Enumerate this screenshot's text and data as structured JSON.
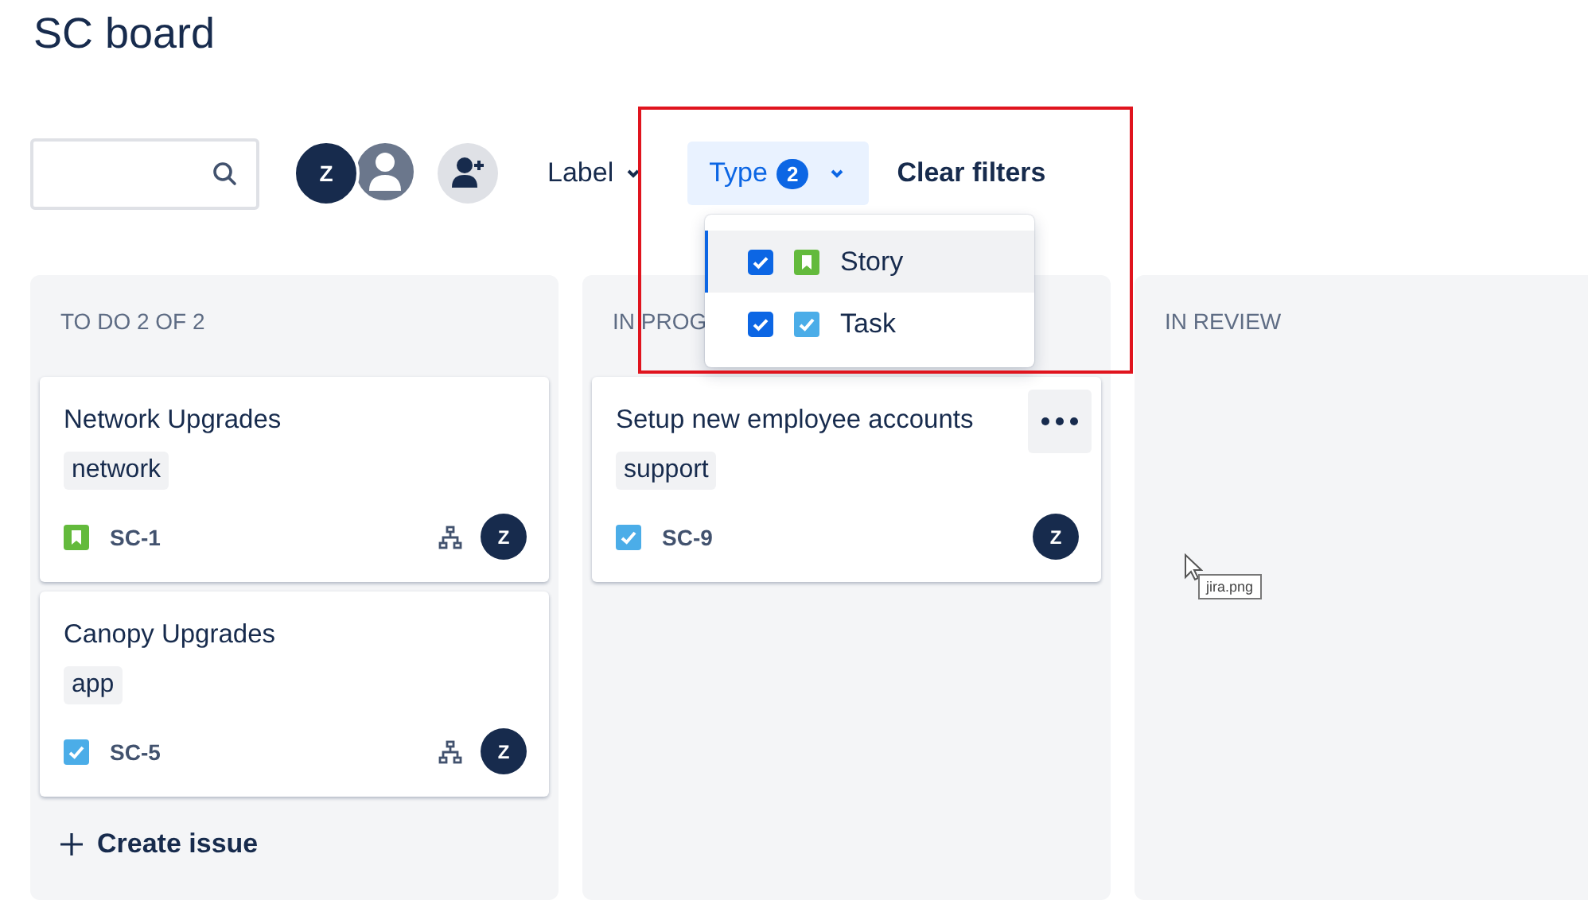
{
  "title": "SC board",
  "toolbar": {
    "avatars": [
      {
        "kind": "initial",
        "text": "Z"
      },
      {
        "kind": "silhouette"
      }
    ],
    "filters": [
      {
        "label": "Label",
        "selected": false
      },
      {
        "label": "Type",
        "count": "2",
        "selected": true
      }
    ],
    "clear": "Clear filters"
  },
  "type_menu": {
    "options": [
      {
        "label": "Story",
        "kind": "story",
        "checked": true,
        "selected": true
      },
      {
        "label": "Task",
        "kind": "task",
        "checked": true,
        "selected": false
      }
    ]
  },
  "columns": [
    {
      "title": "TO DO 2 OF 2",
      "create": "Create issue",
      "cards": [
        {
          "title": "Network Upgrades",
          "label": "network",
          "kind": "story",
          "key": "SC-1",
          "has_children": true,
          "assignee": "Z",
          "show_actions": false
        },
        {
          "title": "Canopy Upgrades",
          "label": "app",
          "kind": "task",
          "key": "SC-5",
          "has_children": true,
          "assignee": "Z",
          "show_actions": false
        }
      ]
    },
    {
      "title": "IN PROG",
      "cards": [
        {
          "title": "Setup new employee accounts",
          "label": "support",
          "kind": "task",
          "key": "SC-9",
          "has_children": false,
          "assignee": "Z",
          "show_actions": true
        }
      ]
    },
    {
      "title": "IN REVIEW"
    }
  ],
  "tooltip": "jira.png"
}
